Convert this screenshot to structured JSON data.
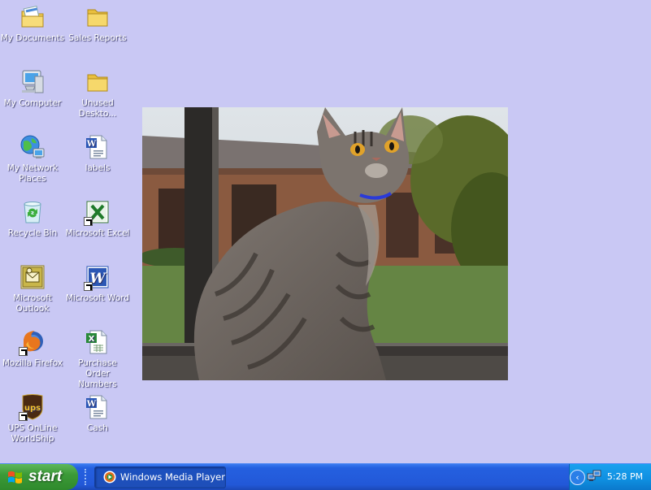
{
  "desktop": {
    "background_color": "#c9c8f4",
    "icons": [
      {
        "id": "my-documents",
        "label": "My Documents",
        "icon": "my-documents-icon"
      },
      {
        "id": "sales-reports",
        "label": "Sales Reports",
        "icon": "folder-icon"
      },
      {
        "id": "my-computer",
        "label": "My Computer",
        "icon": "computer-icon"
      },
      {
        "id": "unused-desktop",
        "label": "Unused Deskto...",
        "icon": "folder-icon"
      },
      {
        "id": "my-network-places",
        "label": "My Network Places",
        "icon": "network-icon"
      },
      {
        "id": "labels",
        "label": "labels",
        "icon": "word-document-icon"
      },
      {
        "id": "recycle-bin",
        "label": "Recycle Bin",
        "icon": "recycle-bin-icon"
      },
      {
        "id": "microsoft-excel",
        "label": "Microsoft Excel",
        "icon": "excel-icon"
      },
      {
        "id": "microsoft-outlook",
        "label": "Microsoft Outlook",
        "icon": "outlook-icon"
      },
      {
        "id": "microsoft-word",
        "label": "Microsoft Word",
        "icon": "word-icon"
      },
      {
        "id": "mozilla-firefox",
        "label": "Mozilla Firefox",
        "icon": "firefox-icon"
      },
      {
        "id": "purchase-order-numbers",
        "label": "Purchase Order Numbers",
        "icon": "excel-document-icon"
      },
      {
        "id": "ups-online-worldship",
        "label": "UPS OnLine WorldShip",
        "icon": "ups-icon"
      },
      {
        "id": "cash",
        "label": "Cash",
        "icon": "word-document-icon"
      }
    ],
    "wallpaper_photo": {
      "subject": "gray tabby cat sitting by a window"
    }
  },
  "taskbar": {
    "start_label": "start",
    "tasks": [
      {
        "label": "Windows Media Player",
        "icon": "windows-media-player-icon"
      }
    ],
    "tray": {
      "chevron_icon": "tray-expand-chevron-icon",
      "network_icon": "network-connection-icon",
      "clock": "5:28 PM"
    }
  }
}
